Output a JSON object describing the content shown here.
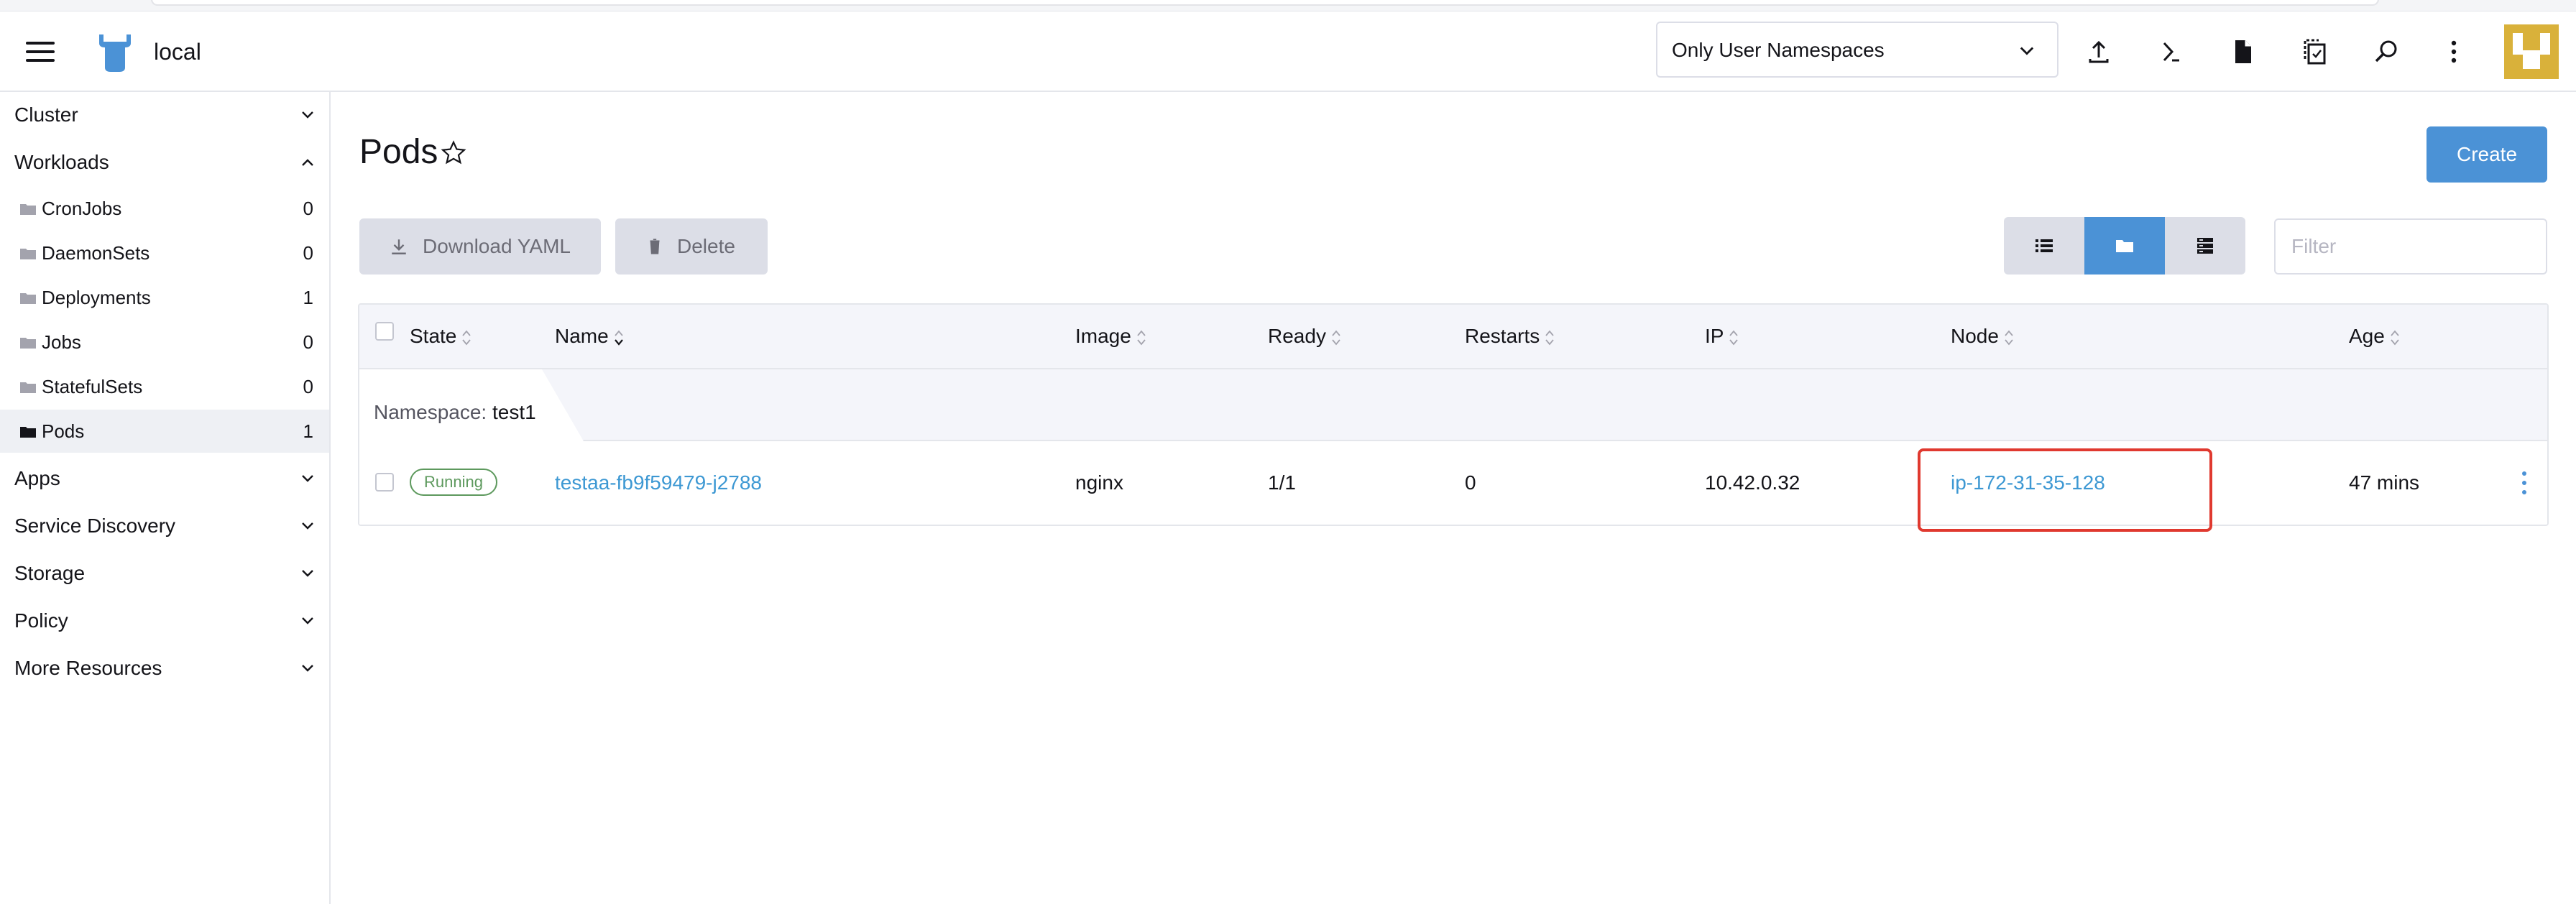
{
  "header": {
    "cluster_name": "local",
    "namespace_filter": "Only User Namespaces"
  },
  "sidebar": {
    "groups": [
      {
        "label": "Cluster"
      },
      {
        "label": "Workloads"
      },
      {
        "label": "Apps"
      },
      {
        "label": "Service Discovery"
      },
      {
        "label": "Storage"
      },
      {
        "label": "Policy"
      },
      {
        "label": "More Resources"
      }
    ],
    "workloads": [
      {
        "label": "CronJobs",
        "count": "0"
      },
      {
        "label": "DaemonSets",
        "count": "0"
      },
      {
        "label": "Deployments",
        "count": "1"
      },
      {
        "label": "Jobs",
        "count": "0"
      },
      {
        "label": "StatefulSets",
        "count": "0"
      },
      {
        "label": "Pods",
        "count": "1"
      }
    ]
  },
  "main": {
    "title": "Pods",
    "create_label": "Create",
    "download_label": "Download YAML",
    "delete_label": "Delete",
    "filter_placeholder": "Filter"
  },
  "table": {
    "columns": [
      "State",
      "Name",
      "Image",
      "Ready",
      "Restarts",
      "IP",
      "Node",
      "Age"
    ],
    "group_key": "Namespace:",
    "group_value": "test1",
    "rows": [
      {
        "state": "Running",
        "name": "testaa-fb9f59479-j2788",
        "image": "nginx",
        "ready": "1/1",
        "restarts": "0",
        "ip": "10.42.0.32",
        "node": "ip-172-31-35-128",
        "age": "47 mins"
      }
    ]
  },
  "colors": {
    "accent": "#4b92d6",
    "link": "#3d98d3",
    "running": "#5d995d",
    "highlight": "#e0392f"
  }
}
